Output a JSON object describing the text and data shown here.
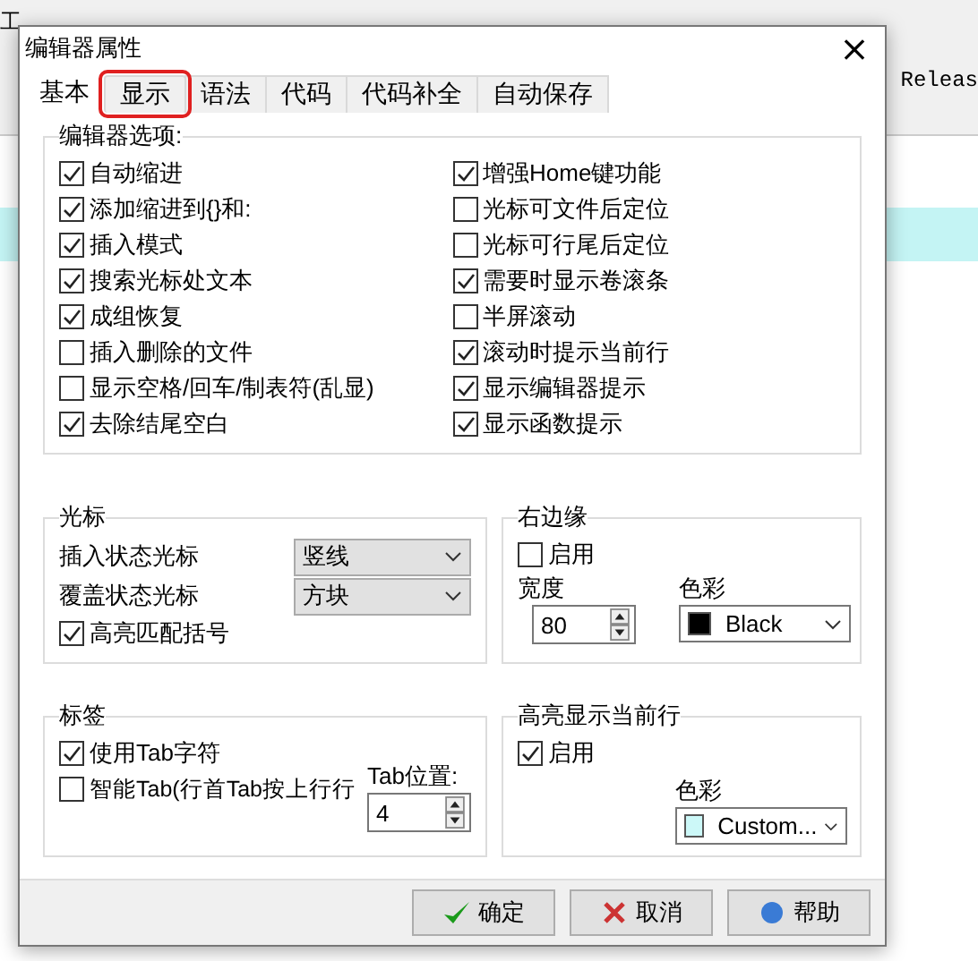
{
  "background": {
    "menu_fragment": "工",
    "editor_text": "Releas"
  },
  "window": {
    "title": "编辑器属性",
    "close": "×"
  },
  "tabs": [
    {
      "label": "基本",
      "selected": true,
      "highlighted": false
    },
    {
      "label": "显示",
      "selected": false,
      "highlighted": true
    },
    {
      "label": "语法",
      "selected": false,
      "highlighted": false
    },
    {
      "label": "代码",
      "selected": false,
      "highlighted": false
    },
    {
      "label": "代码补全",
      "selected": false,
      "highlighted": false
    },
    {
      "label": "自动保存",
      "selected": false,
      "highlighted": false
    }
  ],
  "editor_options": {
    "title": "编辑器选项:",
    "left": [
      {
        "label": "自动缩进",
        "checked": true
      },
      {
        "label": "添加缩进到{}和:",
        "checked": true
      },
      {
        "label": "插入模式",
        "checked": true
      },
      {
        "label": "搜索光标处文本",
        "checked": true
      },
      {
        "label": "成组恢复",
        "checked": true
      },
      {
        "label": "插入删除的文件",
        "checked": false
      },
      {
        "label": "显示空格/回车/制表符(乱显)",
        "checked": false
      },
      {
        "label": "去除结尾空白",
        "checked": true
      }
    ],
    "right": [
      {
        "label": "增强Home键功能",
        "checked": true
      },
      {
        "label": "光标可文件后定位",
        "checked": false
      },
      {
        "label": "光标可行尾后定位",
        "checked": false
      },
      {
        "label": "需要时显示卷滚条",
        "checked": true
      },
      {
        "label": "半屏滚动",
        "checked": false
      },
      {
        "label": "滚动时提示当前行",
        "checked": true
      },
      {
        "label": "显示编辑器提示",
        "checked": true
      },
      {
        "label": "显示函数提示",
        "checked": true
      }
    ]
  },
  "cursor": {
    "title": "光标",
    "insert_label": "插入状态光标",
    "insert_value": "竖线",
    "overwrite_label": "覆盖状态光标",
    "overwrite_value": "方块",
    "match": {
      "label": "高亮匹配括号",
      "checked": true
    }
  },
  "right_margin": {
    "title": "右边缘",
    "enable": {
      "label": "启用",
      "checked": false
    },
    "width_label": "宽度",
    "width_value": "80",
    "color_label": "色彩",
    "color_value": "Black",
    "color": "#000000"
  },
  "tabs_group": {
    "title": "标签",
    "use_tab": {
      "label": "使用Tab字符",
      "checked": true
    },
    "smart_tab": {
      "label": "智能Tab(行首Tab按上行行",
      "checked": false
    },
    "pos_label": "Tab位置:",
    "pos_value": "4"
  },
  "highlight_line": {
    "title": "高亮显示当前行",
    "enable": {
      "label": "启用",
      "checked": true
    },
    "color_label": "色彩",
    "color_value": "Custom...",
    "color": "#ccf8f8"
  },
  "buttons": [
    {
      "label": "确定",
      "kind": "ok"
    },
    {
      "label": "取消",
      "kind": "cancel"
    },
    {
      "label": "帮助",
      "kind": "help"
    }
  ]
}
